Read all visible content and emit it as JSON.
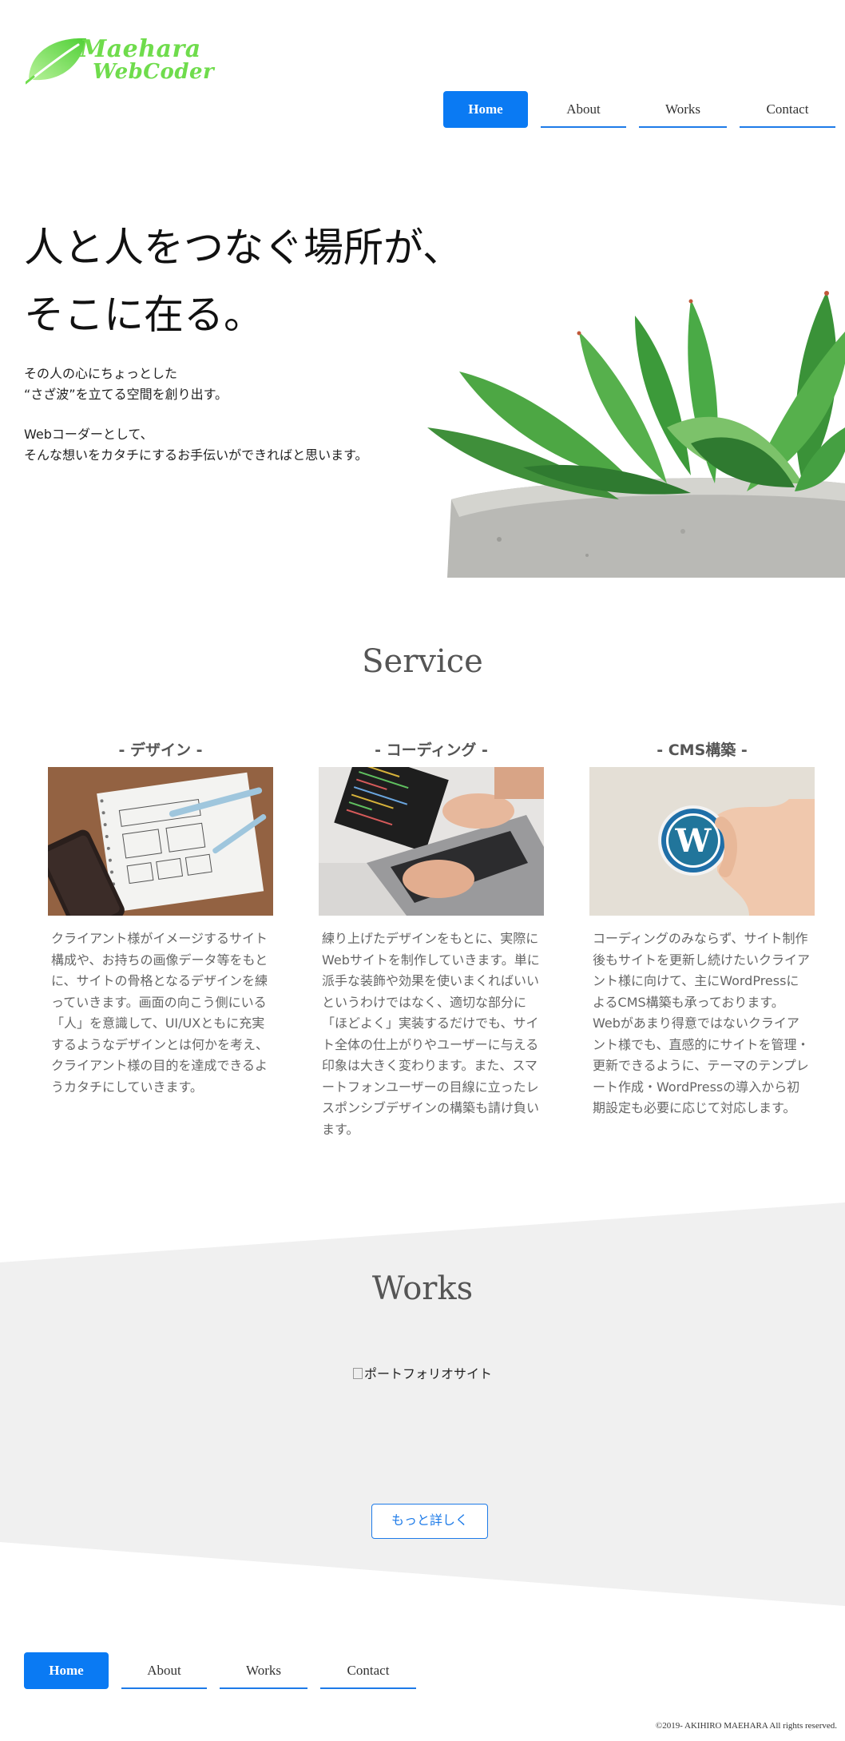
{
  "logo": {
    "line1": "Maehara",
    "line2": "WebCoder",
    "color": "#6fdc4c"
  },
  "nav": {
    "items": [
      {
        "label": "Home",
        "active": true
      },
      {
        "label": "About",
        "active": false
      },
      {
        "label": "Works",
        "active": false
      },
      {
        "label": "Contact",
        "active": false
      }
    ]
  },
  "hero": {
    "title_line1": "人と人をつなぐ場所が、",
    "title_line2": "そこに在る。",
    "para1_line1": "その人の心にちょっとした",
    "para1_line2": "“さざ波”を立てる空間を創り出す。",
    "para2_line1": "Webコーダーとして、",
    "para2_line2": "そんな想いをカタチにするお手伝いができればと思います。",
    "image": "succulent-plant-photo"
  },
  "service": {
    "title": "Service",
    "cards": [
      {
        "heading": "- デザイン -",
        "image": "wireframe-sketch-photo",
        "text": "クライアント様がイメージするサイト構成や、お持ちの画像データ等をもとに、サイトの骨格となるデザインを練っていきます。画面の向こう側にいる「人」を意識して、UI/UXともに充実するようなデザインとは何かを考え、クライアント様の目的を達成できるようカタチにしていきます。"
      },
      {
        "heading": "- コーディング -",
        "image": "laptop-typing-photo",
        "text": "練り上げたデザインをもとに、実際にWebサイトを制作していきます。単に派手な装飾や効果を使いまくればいいというわけではなく、適切な部分に「ほどよく」実装するだけでも、サイト全体の仕上がりやユーザーに与える印象は大きく変わります。また、スマートフォンユーザーの目線に立ったレスポンシブデザインの構築も請け負います。"
      },
      {
        "heading": "- CMS構築 -",
        "image": "wordpress-badge-photo",
        "text": "コーディングのみならず、サイト制作後もサイトを更新し続けたいクライアント様に向けて、主にWordPressによるCMS構築も承っております。Webがあまり得意ではないクライアント様でも、直感的にサイトを管理・更新できるように、テーマのテンプレート作成・WordPressの導入から初期設定も必要に応じて対応します。"
      }
    ]
  },
  "works": {
    "title": "Works",
    "image_alt": "ポートフォリオサイト",
    "more_button": "もっと詳しく",
    "band_color": "#f0f0f0"
  },
  "footer": {
    "copyright": "©2019- AKIHIRO MAEHARA All rights reserved."
  },
  "colors": {
    "accent": "#0a7af3",
    "text_muted": "#666666"
  }
}
